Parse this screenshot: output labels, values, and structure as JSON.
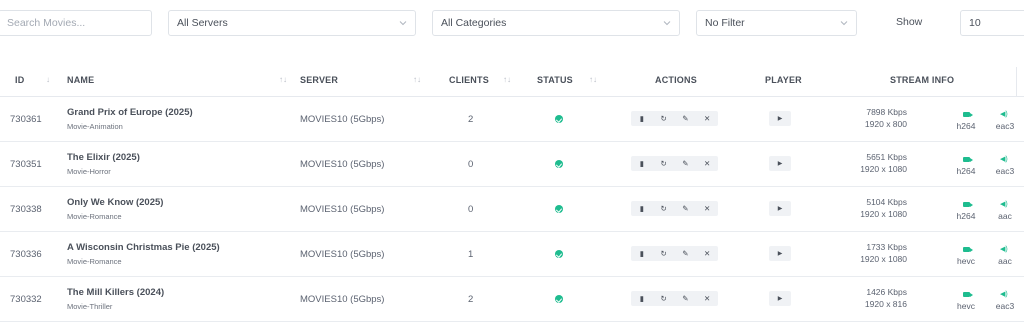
{
  "filters": {
    "search_placeholder": "Search Movies...",
    "server": "All Servers",
    "category": "All Categories",
    "filter": "No Filter",
    "show_label": "Show",
    "show_value": "10"
  },
  "table": {
    "headers": {
      "id": "ID",
      "name": "NAME",
      "server": "SERVER",
      "clients": "CLIENTS",
      "status": "STATUS",
      "actions": "ACTIONS",
      "player": "PLAYER",
      "stream_info": "STREAM INFO"
    },
    "rows": [
      {
        "id": "730361",
        "name": "Grand Prix of Europe (2025)",
        "category": "Movie-Animation",
        "server": "MOVIES10 (5Gbps)",
        "clients": "2",
        "kbps": "7898 Kbps",
        "res": "1920 x 800",
        "video": "h264",
        "audio": "eac3"
      },
      {
        "id": "730351",
        "name": "The Elixir (2025)",
        "category": "Movie-Horror",
        "server": "MOVIES10 (5Gbps)",
        "clients": "0",
        "kbps": "5651 Kbps",
        "res": "1920 x 1080",
        "video": "h264",
        "audio": "eac3"
      },
      {
        "id": "730338",
        "name": "Only We Know (2025)",
        "category": "Movie-Romance",
        "server": "MOVIES10 (5Gbps)",
        "clients": "0",
        "kbps": "5104 Kbps",
        "res": "1920 x 1080",
        "video": "h264",
        "audio": "aac"
      },
      {
        "id": "730336",
        "name": "A Wisconsin Christmas Pie (2025)",
        "category": "Movie-Romance",
        "server": "MOVIES10 (5Gbps)",
        "clients": "1",
        "kbps": "1733 Kbps",
        "res": "1920 x 1080",
        "video": "hevc",
        "audio": "aac"
      },
      {
        "id": "730332",
        "name": "The Mill Killers (2024)",
        "category": "Movie-Thriller",
        "server": "MOVIES10 (5Gbps)",
        "clients": "2",
        "kbps": "1426 Kbps",
        "res": "1920 x 816",
        "video": "hevc",
        "audio": "eac3"
      }
    ]
  },
  "icons": {
    "sort": "sort-arrows-icon",
    "status": "check-circle-icon",
    "actions": [
      "document-icon",
      "refresh-icon",
      "pencil-icon",
      "close-icon"
    ],
    "player": "play-icon",
    "video": "video-camera-icon",
    "audio": "speaker-icon"
  },
  "colors": {
    "status_ok": "#1ebc8f"
  }
}
